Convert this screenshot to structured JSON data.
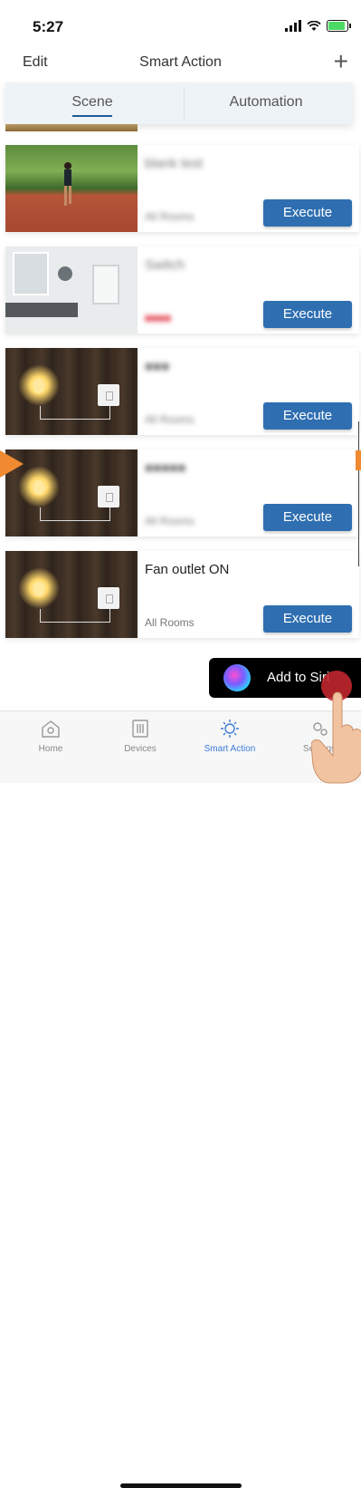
{
  "status": {
    "time": "5:27"
  },
  "nav": {
    "edit": "Edit",
    "title": "Smart Action",
    "add": "+"
  },
  "tabs": [
    {
      "label": "Scene",
      "active": true
    },
    {
      "label": "Automation",
      "active": false
    }
  ],
  "scenes": [
    {
      "name": "blank test",
      "room": "All Rooms",
      "action": "Execute",
      "thumb": "track",
      "blur": true
    },
    {
      "name": "Switch",
      "room": "■■■■",
      "action": "Execute",
      "thumb": "bathroom",
      "blur": true
    },
    {
      "name": "■■■",
      "room": "All Rooms",
      "action": "Execute",
      "thumb": "bulb",
      "blur": true
    },
    {
      "name": "■■■■■",
      "room": "All Rooms",
      "action": "Execute",
      "thumb": "bulb",
      "blur": true
    },
    {
      "name": "Fan outlet ON",
      "room": "All Rooms",
      "action": "Execute",
      "thumb": "bulb",
      "blur": false
    }
  ],
  "siri": {
    "label": "Add to Siri"
  },
  "tabbar": [
    {
      "label": "Home",
      "icon": "home-icon",
      "active": false
    },
    {
      "label": "Devices",
      "icon": "devices-icon",
      "active": false
    },
    {
      "label": "Smart Action",
      "icon": "smart-action-icon",
      "active": true
    },
    {
      "label": "Settings",
      "icon": "settings-icon",
      "active": false
    }
  ],
  "colors": {
    "accent": "#2f6fb1",
    "tab_active": "#3a7bd5",
    "pointer": "#f08a30"
  }
}
